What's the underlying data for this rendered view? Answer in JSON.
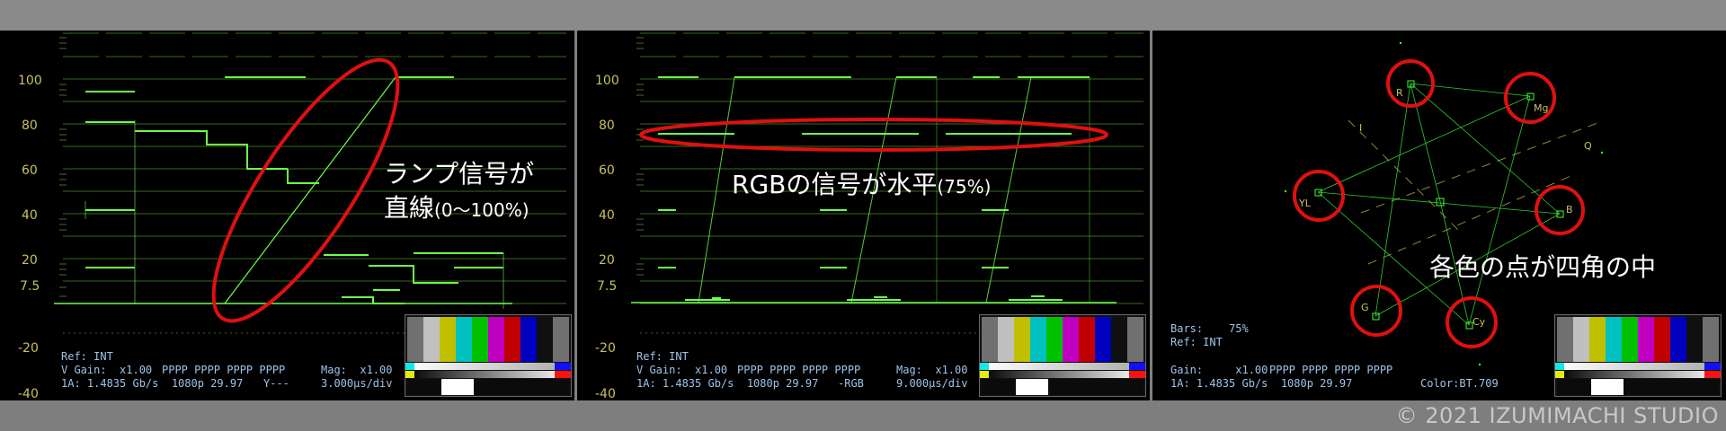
{
  "copyright": "© 2021 IZUMIMACHI STUDIO",
  "waveform_ticks": [
    "100",
    "80",
    "60",
    "40",
    "20",
    "7.5",
    "-20",
    "-40"
  ],
  "panel1": {
    "annotation_line1": "ランプ信号が",
    "annotation_line2": "直線",
    "annotation_line2_small": "(0〜100%)",
    "ref": "Ref: INT",
    "vgain_label": "V Gain:  x1.00",
    "vgain_bits": "PPPP PPPP PPPP PPPP",
    "mag": "Mag:  x1.00",
    "status": "1A: 1.4835 Gb/s  1080p 29.97",
    "mode": "Y---",
    "timescale": "3.000μs/div"
  },
  "panel2": {
    "annotation": "RGBの信号が水平",
    "annotation_small": "(75%)",
    "ref": "Ref: INT",
    "vgain_label": "V Gain:  x1.00",
    "vgain_bits": "PPPP PPPP PPPP PPPP",
    "mag": "Mag:  x1.00",
    "status": "1A: 1.4835 Gb/s  1080p 29.97",
    "mode": "-RGB",
    "timescale": "9.000μs/div"
  },
  "panel3": {
    "annotation": "各色の点が四角の中",
    "bars": "Bars:    75%",
    "ref": "Ref: INT",
    "gain_label": "Gain:     x1.00",
    "gain_bits": "PPPP PPPP PPPP PPPP",
    "status": "1A: 1.4835 Gb/s  1080p 29.97",
    "color": "Color:BT.709",
    "targets": {
      "R": "R",
      "Mg": "Mg",
      "B": "B",
      "Cy": "Cy",
      "G": "G",
      "YL": "YL",
      "I": "I",
      "Q": "Q"
    }
  },
  "colors": {
    "trace": "#6cff4a",
    "graticule": "#3a6a1a",
    "label": "#c8c060",
    "annotation_circle": "#e01010",
    "info_text": "#9ec3e8"
  }
}
